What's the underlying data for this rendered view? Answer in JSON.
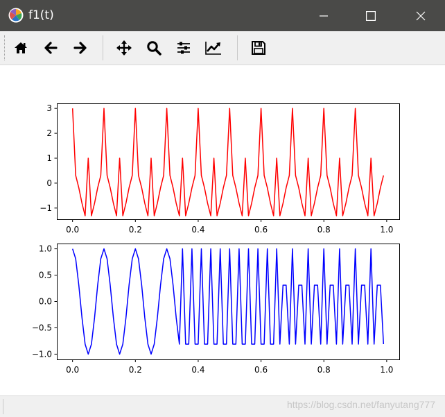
{
  "window": {
    "title": "f1(t)",
    "minimize_icon": "minimize-icon",
    "maximize_icon": "maximize-icon",
    "close_icon": "close-icon"
  },
  "toolbar": {
    "buttons": [
      {
        "name": "home",
        "icon": "home-icon"
      },
      {
        "name": "back",
        "icon": "arrow-left-icon"
      },
      {
        "name": "forward",
        "icon": "arrow-right-icon"
      },
      {
        "name": "pan",
        "icon": "move-icon"
      },
      {
        "name": "zoom",
        "icon": "magnifier-icon"
      },
      {
        "name": "configure-subplots",
        "icon": "sliders-icon"
      },
      {
        "name": "edit-axis",
        "icon": "line-chart-icon"
      },
      {
        "name": "save",
        "icon": "floppy-disk-icon"
      }
    ]
  },
  "status": {
    "watermark": "https://blog.csdn.net/fanyutang777"
  },
  "chart_data": [
    {
      "type": "line",
      "color": "#ff0000",
      "xlim": [
        -0.05,
        1.04
      ],
      "ylim": [
        -1.45,
        3.2
      ],
      "xticks": [
        0.0,
        0.2,
        0.4,
        0.6,
        0.8,
        1.0
      ],
      "xtick_labels": [
        "0.0",
        "0.2",
        "0.4",
        "0.6",
        "0.8",
        "1.0"
      ],
      "yticks": [
        -1,
        0,
        1,
        2,
        3
      ],
      "ytick_labels": [
        "−1",
        "0",
        "1",
        "2",
        "3"
      ],
      "grid": false,
      "x": [
        0.0,
        0.01,
        0.02,
        0.03,
        0.04,
        0.05,
        0.06,
        0.07,
        0.08,
        0.09,
        0.1,
        0.11,
        0.12,
        0.13,
        0.14,
        0.15,
        0.16,
        0.17,
        0.18,
        0.19,
        0.2,
        0.21,
        0.22,
        0.23,
        0.24,
        0.25,
        0.26,
        0.27,
        0.28,
        0.29,
        0.3,
        0.31,
        0.32,
        0.33,
        0.34,
        0.35,
        0.36,
        0.37,
        0.38,
        0.39,
        0.4,
        0.41,
        0.42,
        0.43,
        0.44,
        0.45,
        0.46,
        0.47,
        0.48,
        0.49,
        0.5,
        0.51,
        0.52,
        0.53,
        0.54,
        0.55,
        0.56,
        0.57,
        0.58,
        0.59,
        0.6,
        0.61,
        0.62,
        0.63,
        0.64,
        0.65,
        0.66,
        0.67,
        0.68,
        0.69,
        0.7,
        0.71,
        0.72,
        0.73,
        0.74,
        0.75,
        0.76,
        0.77,
        0.78,
        0.79,
        0.8,
        0.81,
        0.82,
        0.83,
        0.84,
        0.85,
        0.86,
        0.87,
        0.88,
        0.89,
        0.9,
        0.91,
        0.92,
        0.93,
        0.94,
        0.95,
        0.96,
        0.97,
        0.98,
        0.99
      ],
      "y": [
        3.0,
        0.31,
        -0.19,
        -0.81,
        -1.31,
        1.0,
        -1.31,
        -0.81,
        -0.19,
        0.31,
        3.0,
        0.31,
        -0.19,
        -0.81,
        -1.31,
        1.0,
        -1.31,
        -0.81,
        -0.19,
        0.31,
        3.0,
        0.31,
        -0.19,
        -0.81,
        -1.31,
        1.0,
        -1.31,
        -0.81,
        -0.19,
        0.31,
        3.0,
        0.31,
        -0.19,
        -0.81,
        -1.31,
        1.0,
        -1.31,
        -0.81,
        -0.19,
        0.31,
        3.0,
        0.31,
        -0.19,
        -0.81,
        -1.31,
        1.0,
        -1.31,
        -0.81,
        -0.19,
        0.31,
        3.0,
        0.31,
        -0.19,
        -0.81,
        -1.31,
        1.0,
        -1.31,
        -0.81,
        -0.19,
        0.31,
        3.0,
        0.31,
        -0.19,
        -0.81,
        -1.31,
        1.0,
        -1.31,
        -0.81,
        -0.19,
        0.31,
        3.0,
        0.31,
        -0.19,
        -0.81,
        -1.31,
        1.0,
        -1.31,
        -0.81,
        -0.19,
        0.31,
        3.0,
        0.31,
        -0.19,
        -0.81,
        -1.31,
        1.0,
        -1.31,
        -0.81,
        -0.19,
        0.31,
        3.0,
        0.31,
        -0.19,
        -0.81,
        -1.31,
        1.0,
        -1.31,
        -0.81,
        -0.19,
        0.31
      ]
    },
    {
      "type": "line",
      "color": "#0000ff",
      "xlim": [
        -0.05,
        1.04
      ],
      "ylim": [
        -1.1,
        1.1
      ],
      "xticks": [
        0.0,
        0.2,
        0.4,
        0.6,
        0.8,
        1.0
      ],
      "xtick_labels": [
        "0.0",
        "0.2",
        "0.4",
        "0.6",
        "0.8",
        "1.0"
      ],
      "yticks": [
        -1.0,
        -0.5,
        0.0,
        0.5,
        1.0
      ],
      "ytick_labels": [
        "−1.0",
        "−0.5",
        "0.0",
        "0.5",
        "1.0"
      ],
      "grid": false,
      "x": [
        0.0,
        0.01,
        0.02,
        0.03,
        0.04,
        0.05,
        0.06,
        0.07,
        0.08,
        0.09,
        0.1,
        0.11,
        0.12,
        0.13,
        0.14,
        0.15,
        0.16,
        0.17,
        0.18,
        0.19,
        0.2,
        0.21,
        0.22,
        0.23,
        0.24,
        0.25,
        0.26,
        0.27,
        0.28,
        0.29,
        0.3,
        0.31,
        0.32,
        0.33,
        0.34,
        0.35,
        0.36,
        0.37,
        0.38,
        0.39,
        0.4,
        0.41,
        0.42,
        0.43,
        0.44,
        0.45,
        0.46,
        0.47,
        0.48,
        0.49,
        0.5,
        0.51,
        0.52,
        0.53,
        0.54,
        0.55,
        0.56,
        0.57,
        0.58,
        0.59,
        0.6,
        0.61,
        0.62,
        0.63,
        0.64,
        0.65,
        0.66,
        0.67,
        0.68,
        0.69,
        0.7,
        0.71,
        0.72,
        0.73,
        0.74,
        0.75,
        0.76,
        0.77,
        0.78,
        0.79,
        0.8,
        0.81,
        0.82,
        0.83,
        0.84,
        0.85,
        0.86,
        0.87,
        0.88,
        0.89,
        0.9,
        0.91,
        0.92,
        0.93,
        0.94,
        0.95,
        0.96,
        0.97,
        0.98,
        0.99
      ],
      "y": [
        1.0,
        0.81,
        0.31,
        -0.31,
        -0.81,
        -1.0,
        -0.81,
        -0.31,
        0.31,
        0.81,
        1.0,
        0.81,
        0.31,
        -0.31,
        -0.81,
        -1.0,
        -0.81,
        -0.31,
        0.31,
        0.81,
        1.0,
        0.81,
        0.31,
        -0.31,
        -0.81,
        -1.0,
        -0.81,
        -0.31,
        0.31,
        0.81,
        1.0,
        0.81,
        0.31,
        -0.31,
        -0.81,
        1.0,
        -0.81,
        -0.81,
        1.0,
        -0.81,
        -0.81,
        1.0,
        -0.81,
        -0.81,
        1.0,
        -0.81,
        -0.81,
        1.0,
        -0.81,
        -0.81,
        1.0,
        -0.81,
        -0.81,
        1.0,
        -0.81,
        -0.81,
        1.0,
        -0.81,
        -0.81,
        1.0,
        -0.81,
        -0.81,
        1.0,
        -0.81,
        -0.81,
        1.0,
        -0.81,
        0.31,
        0.31,
        -0.81,
        1.0,
        -0.81,
        0.31,
        0.31,
        -0.81,
        1.0,
        -0.81,
        0.31,
        0.31,
        -0.81,
        1.0,
        -0.81,
        0.31,
        0.31,
        -0.81,
        1.0,
        -0.81,
        0.31,
        0.31,
        -0.81,
        1.0,
        -0.81,
        0.31,
        0.31,
        -0.81,
        1.0,
        -0.81,
        0.31,
        0.31,
        -0.81
      ]
    }
  ]
}
